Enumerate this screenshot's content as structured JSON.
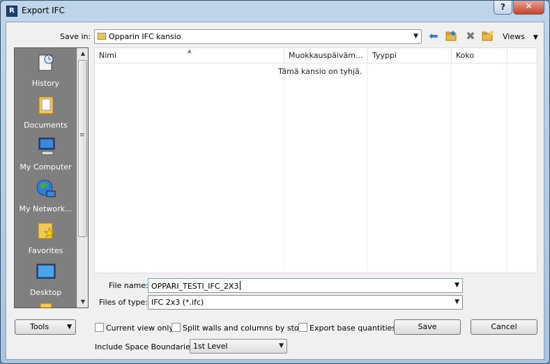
{
  "window": {
    "title": "Export IFC",
    "app_icon_letter": "R"
  },
  "titlebar": {
    "help_glyph": "?",
    "close_glyph": "✕"
  },
  "toolbar": {
    "save_in_label": "Save in:",
    "save_in_value": "Opparin IFC kansio",
    "back_icon": "left-arrow-icon",
    "up_icon": "up-folder-icon",
    "delete_icon": "delete-icon",
    "new_folder_icon": "new-folder-icon",
    "views_label": "Views"
  },
  "places": {
    "items": [
      {
        "label": "History",
        "icon": "history-icon"
      },
      {
        "label": "Documents",
        "icon": "documents-icon"
      },
      {
        "label": "My Computer",
        "icon": "computer-icon"
      },
      {
        "label": "My Network...",
        "icon": "network-icon"
      },
      {
        "label": "Favorites",
        "icon": "favorites-icon"
      },
      {
        "label": "Desktop",
        "icon": "desktop-icon"
      }
    ]
  },
  "filelist": {
    "columns": [
      "Nimi",
      "Muokkauspäiväm...",
      "Tyyppi",
      "Koko"
    ],
    "empty_message": "Tämä kansio on tyhjä."
  },
  "form": {
    "filename_label": "File name:",
    "filename_value": "OPPARI_TESTI_IFC_2X3",
    "filetype_label": "Files of type:",
    "filetype_value": "IFC 2x3 (*.ifc)"
  },
  "options": {
    "tools_label": "Tools",
    "current_view_only": "Current view only",
    "split_walls": "Split walls and columns by story",
    "export_base_quantities": "Export base quantities",
    "space_boundaries_label": "Include Space Boundaries:",
    "space_boundaries_value": "1st Level"
  },
  "buttons": {
    "save": "Save",
    "cancel": "Cancel"
  },
  "colors": {
    "titlebar": "#bfd5ea",
    "places_bg": "#7f7f7f",
    "close_red": "#c7412a"
  }
}
